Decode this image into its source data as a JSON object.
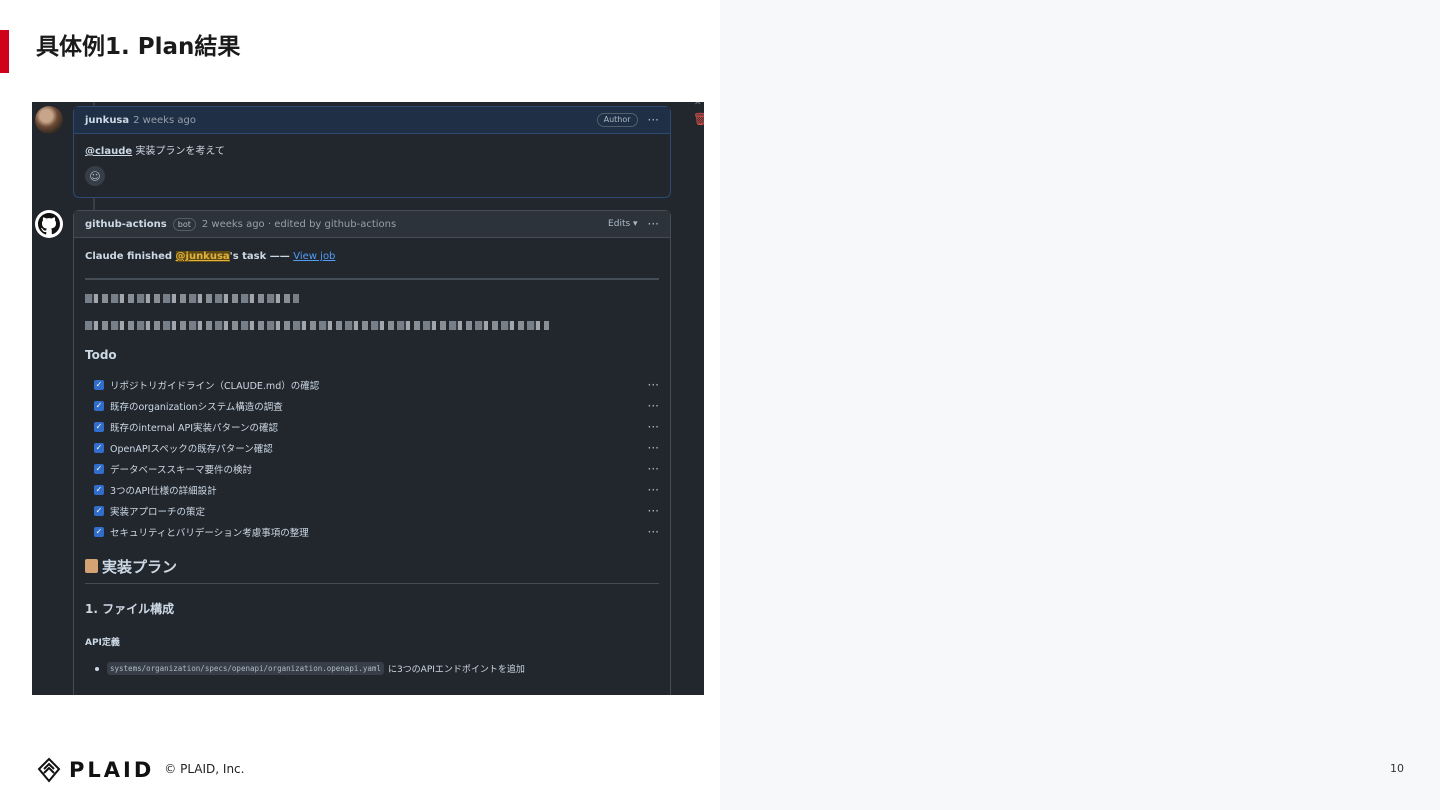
{
  "slide": {
    "title": "具体例1. Plan結果",
    "accent_color": "#d0021b",
    "page_number": "10"
  },
  "footer": {
    "logo_text": "PLAID",
    "copyright": "© PLAID, Inc."
  },
  "comment1": {
    "user": "junkusa",
    "time": "2 weeks ago",
    "badge": "Author",
    "menu": "···",
    "mention": "@claude",
    "body": " 実装プランを考えて",
    "reaction_icon": "☺"
  },
  "comment2": {
    "user": "github-actions",
    "bot_badge": "bot",
    "meta": "2 weeks ago · edited by github-actions",
    "edits": "Edits ▾",
    "menu": "···",
    "finished_prefix": "Claude finished ",
    "finished_mention": "@junkusa",
    "finished_suffix": "'s task —— ",
    "view_job": "View job",
    "todo_title": "Todo",
    "todos": [
      "リポジトリガイドライン（CLAUDE.md）の確認",
      "既存のorganizationシステム構造の調査",
      "既存のinternal API実装パターンの確認",
      "OpenAPIスペックの既存パターン確認",
      "データベーススキーマ要件の検討",
      "3つのAPI仕様の詳細設計",
      "実装アプローチの策定",
      "セキュリティとバリデーション考慮事項の整理"
    ],
    "plan_heading": "実装プラン",
    "section1": "1. ファイル構成",
    "api_def": "API定義",
    "code_path": "systems/organization/specs/openapi/organization.openapi.yaml",
    "code_suffix": "に3つのAPIエンドポイントを追加"
  },
  "icons": {
    "trash": "trash-icon",
    "smiley": "smiley-icon",
    "github": "github-icon",
    "check": "✓",
    "clipboard": "clipboard-icon"
  }
}
